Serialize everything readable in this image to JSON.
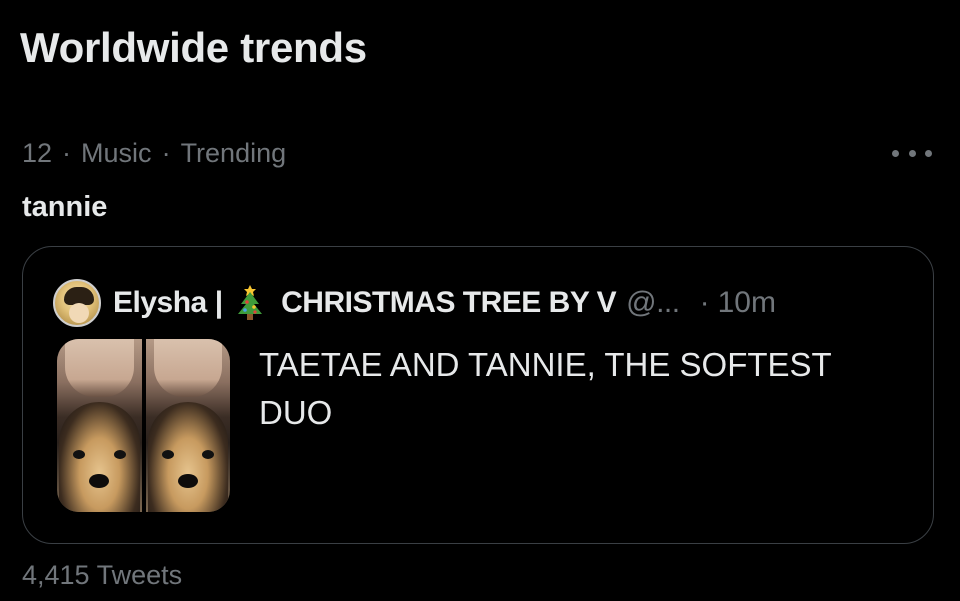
{
  "section": {
    "title": "Worldwide trends"
  },
  "trend": {
    "rank": "12",
    "separator": "·",
    "category": "Music",
    "status": "Trending",
    "name": "tannie",
    "tweet_count": "4,415 Tweets",
    "more_icon": "more-horizontal-icon"
  },
  "tweet": {
    "author_name": "Elysha",
    "pipe": "|",
    "emoji_icon": "christmas-tree-icon",
    "author_suffix": "CHRISTMAS TREE BY V",
    "handle": "@...",
    "time_sep": "·",
    "time": "10m",
    "text": "TAETAE AND TANNIE, THE SOFTEST DUO"
  },
  "colors": {
    "background": "#000000",
    "primary_text": "#e7e9ea",
    "secondary_text": "#71767b",
    "border": "#3a3f44"
  }
}
